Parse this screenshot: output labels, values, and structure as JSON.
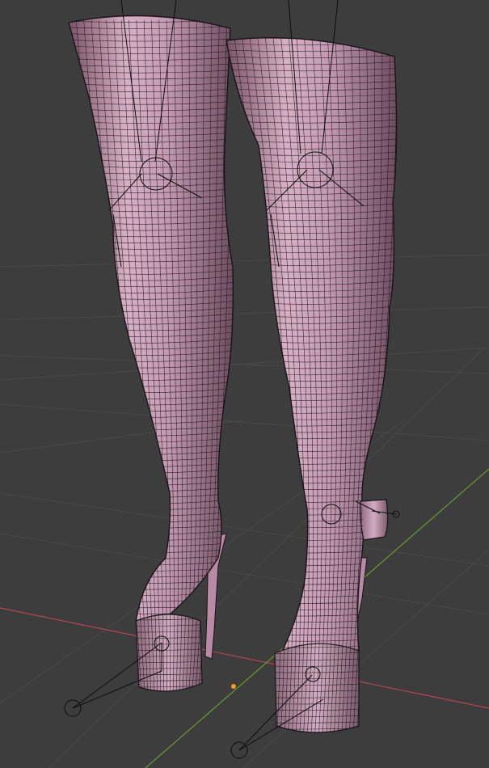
{
  "viewport": {
    "background": "#3d3d3d",
    "grid_color": "#4a4a4a",
    "x_axis_color": "#b34752",
    "y_axis_color": "#6b9a2f",
    "origin_color": "#f0a020"
  },
  "mesh": {
    "fill_light": "#e8c4d8",
    "fill_mid": "#b98aa5",
    "fill_dark": "#6e4c60",
    "wire_color": "#1a1418"
  },
  "rig": {
    "line_color": "#0d0d0d"
  },
  "objects": [
    {
      "label": "right-boot"
    },
    {
      "label": "left-boot"
    }
  ]
}
